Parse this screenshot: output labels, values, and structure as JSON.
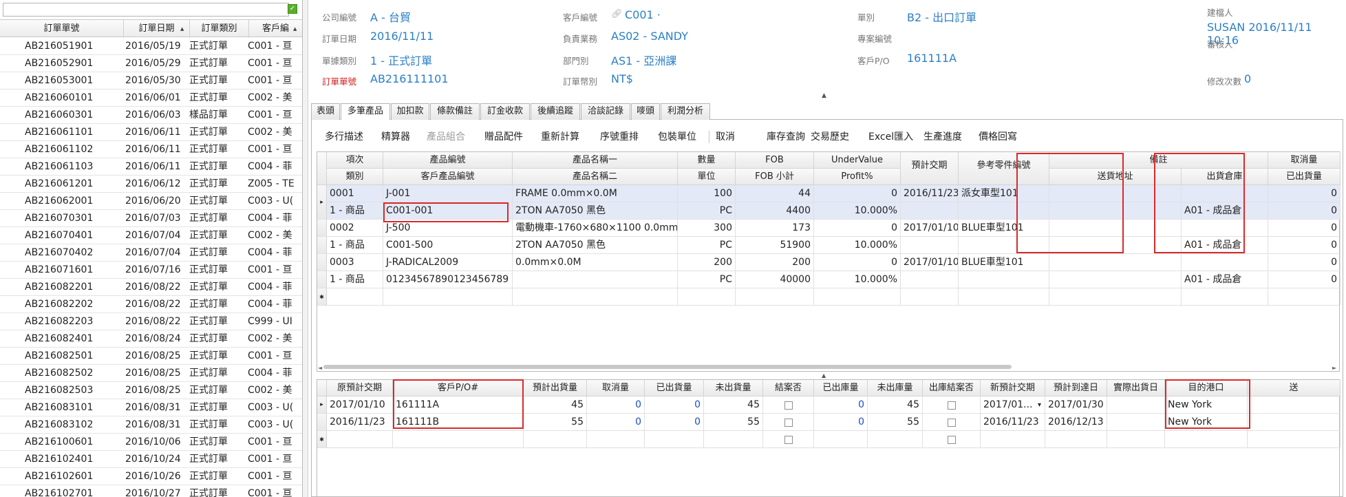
{
  "left_panel": {
    "search_placeholder": "",
    "search_button": "✓",
    "columns": [
      "訂單單號",
      "訂單日期",
      "訂單類別",
      "客戶編"
    ],
    "rows": [
      [
        "AB216051901",
        "2016/05/19",
        "正式訂單",
        "C001 - 亘"
      ],
      [
        "AB216052901",
        "2016/05/29",
        "正式訂單",
        "C001 - 亘"
      ],
      [
        "AB216053001",
        "2016/05/30",
        "正式訂單",
        "C001 - 亘"
      ],
      [
        "AB216060101",
        "2016/06/01",
        "正式訂單",
        "C002 - 美"
      ],
      [
        "AB216060301",
        "2016/06/03",
        "樣品訂單",
        "C001 - 亘"
      ],
      [
        "AB216061101",
        "2016/06/11",
        "正式訂單",
        "C002 - 美"
      ],
      [
        "AB216061102",
        "2016/06/11",
        "正式訂單",
        "C001 - 亘"
      ],
      [
        "AB216061103",
        "2016/06/11",
        "正式訂單",
        "C004 - 菲"
      ],
      [
        "AB216061201",
        "2016/06/12",
        "正式訂單",
        "Z005 - TE"
      ],
      [
        "AB216062001",
        "2016/06/20",
        "正式訂單",
        "C003 - U("
      ],
      [
        "AB216070301",
        "2016/07/03",
        "正式訂單",
        "C004 - 菲"
      ],
      [
        "AB216070401",
        "2016/07/04",
        "正式訂單",
        "C002 - 美"
      ],
      [
        "AB216070402",
        "2016/07/04",
        "正式訂單",
        "C004 - 菲"
      ],
      [
        "AB216071601",
        "2016/07/16",
        "正式訂單",
        "C001 - 亘"
      ],
      [
        "AB216082201",
        "2016/08/22",
        "正式訂單",
        "C004 - 菲"
      ],
      [
        "AB216082202",
        "2016/08/22",
        "正式訂單",
        "C004 - 菲"
      ],
      [
        "AB216082203",
        "2016/08/22",
        "正式訂單",
        "C999 - UI"
      ],
      [
        "AB216082401",
        "2016/08/24",
        "正式訂單",
        "C002 - 美"
      ],
      [
        "AB216082501",
        "2016/08/25",
        "正式訂單",
        "C001 - 亘"
      ],
      [
        "AB216082502",
        "2016/08/25",
        "正式訂單",
        "C004 - 菲"
      ],
      [
        "AB216082503",
        "2016/08/25",
        "正式訂單",
        "C002 - 美"
      ],
      [
        "AB216083101",
        "2016/08/31",
        "正式訂單",
        "C003 - U("
      ],
      [
        "AB216083102",
        "2016/08/31",
        "正式訂單",
        "C003 - U("
      ],
      [
        "AB216100601",
        "2016/10/06",
        "正式訂單",
        "C001 - 亘"
      ],
      [
        "AB216102401",
        "2016/10/24",
        "正式訂單",
        "C001 - 亘"
      ],
      [
        "AB216102601",
        "2016/10/26",
        "正式訂單",
        "C001 - 亘"
      ],
      [
        "AB216102701",
        "2016/10/27",
        "正式訂單",
        "C001 - 亘"
      ]
    ]
  },
  "header": {
    "company_label": "公司編號",
    "company": "A - 台貿",
    "order_date_label": "訂單日期",
    "order_date": "2016/11/11",
    "doc_type_label": "單據類別",
    "doc_type": "1 - 正式訂單",
    "order_no_label": "訂單單號",
    "order_no": "AB216111101",
    "customer_label": "客戶編號",
    "customer": "C001 ·",
    "sales_label": "負責業務",
    "sales": "AS02 - SANDY",
    "dept_label": "部門別",
    "dept": "AS1 - 亞洲課",
    "currency_label": "訂單幣別",
    "currency": "NT$",
    "doc_kind_label": "單別",
    "doc_kind": "B2 - 出口訂單",
    "project_label": "專案編號",
    "project": "",
    "po_label": "客戶P/O",
    "po": "161111A",
    "creator_label": "建檔人",
    "creator": "SUSAN 2016/11/11 10:16",
    "reviewer_label": "審核人",
    "reviewer": "",
    "revise_label": "修改次數",
    "revise": "0"
  },
  "tabs": [
    "表頭",
    "多筆產品",
    "加扣款",
    "條款備註",
    "訂金收款",
    "後續追蹤",
    "洽談記錄",
    "嘜頭",
    "利潤分析"
  ],
  "toolbar": [
    "多行描述",
    "精算器",
    "產品組合",
    "贈品配件",
    "重新計算",
    "序號重排",
    "包裝單位",
    "取消",
    "庫存查詢",
    "交易歷史",
    "Excel匯入",
    "生產進度",
    "價格回寫"
  ],
  "grid1": {
    "head_top": [
      "項次",
      "產品編號",
      "產品名稱一",
      "數量",
      "FOB",
      "UnderValue",
      "預計交期",
      "參考零件編號",
      "備註",
      "",
      "取消量"
    ],
    "head_bottom": [
      "類別",
      "客戶產品編號",
      "產品名稱二",
      "單位",
      "FOB 小計",
      "Profit%",
      "",
      "",
      "送貨地址",
      "出貨倉庫",
      "已出貨量"
    ],
    "rows": [
      {
        "a": [
          "0001",
          "J-001",
          "FRAME  0.0mm×0.0M",
          "100",
          "44",
          "0",
          "2016/11/23",
          "派女車型101",
          "",
          "",
          "0"
        ],
        "b": [
          "1 - 商品",
          "C001-001",
          "2TON AA7050 黑色",
          "PC",
          "4400",
          "10.000%",
          "",
          "",
          "",
          "A01 - 成品倉",
          "0"
        ]
      },
      {
        "a": [
          "0002",
          "J-500",
          "電動機車-1760×680×1100  0.0mm...",
          "300",
          "173",
          "0",
          "2017/01/10",
          "BLUE車型101",
          "",
          "",
          "0"
        ],
        "b": [
          "1 - 商品",
          "C001-500",
          "2TON AA7050 黑色",
          "PC",
          "51900",
          "10.000%",
          "",
          "",
          "",
          "A01 - 成品倉",
          "0"
        ]
      },
      {
        "a": [
          "0003",
          "J-RADICAL2009",
          " 0.0mm×0.0M",
          "200",
          "200",
          "0",
          "2017/01/10",
          "BLUE車型101",
          "",
          "",
          "0"
        ],
        "b": [
          "1 - 商品",
          "01234567890123456789",
          "",
          "PC",
          "40000",
          "10.000%",
          "",
          "",
          "",
          "A01 - 成品倉",
          "0"
        ]
      }
    ]
  },
  "grid2": {
    "headers": [
      "原預計交期",
      "客戶P/O#",
      "預計出貨量",
      "取消量",
      "已出貨量",
      "未出貨量",
      "結案否",
      "已出庫量",
      "未出庫量",
      "出庫結案否",
      "新預計交期",
      "預計到達日",
      "實際出貨日",
      "目的港口",
      "送"
    ],
    "rows": [
      [
        "2017/01/10",
        "161111A",
        "45",
        "0",
        "0",
        "45",
        "",
        "0",
        "45",
        "",
        "2017/01...",
        "2017/01/30",
        "",
        "New York"
      ],
      [
        "2016/11/23",
        "161111B",
        "55",
        "0",
        "0",
        "55",
        "",
        "0",
        "55",
        "",
        "2016/11/23",
        "2016/12/13",
        "",
        "New York"
      ]
    ]
  },
  "colors": {
    "accent": "#2a7fc6",
    "highlight": "#d9292b",
    "selected_row": "#e4e9f7"
  }
}
